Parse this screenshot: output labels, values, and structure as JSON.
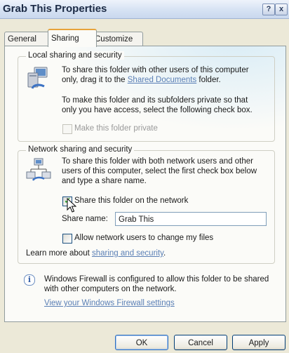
{
  "window": {
    "title": "Grab This Properties",
    "help_glyph": "?",
    "close_glyph": "x"
  },
  "tabs": [
    {
      "label": "General",
      "selected": false
    },
    {
      "label": "Sharing",
      "selected": true
    },
    {
      "label": "Customize",
      "selected": false
    }
  ],
  "local_sharing": {
    "legend": "Local sharing and security",
    "icon": "computer-share-icon",
    "text_line1": "To share this folder with other users of this computer",
    "text_line2_prefix": "only, drag it to the ",
    "shared_documents_link": "Shared Documents",
    "text_line2_suffix": " folder.",
    "private_line1": "To make this folder and its subfolders private so that",
    "private_line2": "only you have access, select the following check box.",
    "make_private_label": "Make this folder private",
    "make_private_checked": false,
    "make_private_enabled": false
  },
  "network_sharing": {
    "legend": "Network sharing and security",
    "icon": "network-share-icon",
    "text_line1": "To share this folder with both network users and other",
    "text_line2": "users of this computer, select the first check box below",
    "text_line3": "and type a share name.",
    "share_label": "Share this folder on the network",
    "share_checked": true,
    "share_name_label": "Share name:",
    "share_name_value": "Grab This",
    "allow_change_label": "Allow network users to change my files",
    "allow_change_checked": false,
    "learn_more_prefix": "Learn more about ",
    "learn_more_link": "sharing and security",
    "learn_more_suffix": "."
  },
  "firewall": {
    "icon": "info-icon",
    "text_line1": "Windows Firewall is configured to allow this folder to be shared",
    "text_line2": "with other computers on the network.",
    "settings_link": "View your Windows Firewall settings"
  },
  "buttons": {
    "ok": "OK",
    "cancel": "Cancel",
    "apply": "Apply"
  },
  "colors": {
    "link": "#5a7fb5",
    "check": "#21a121",
    "dialog_bg": "#ece9d8"
  }
}
